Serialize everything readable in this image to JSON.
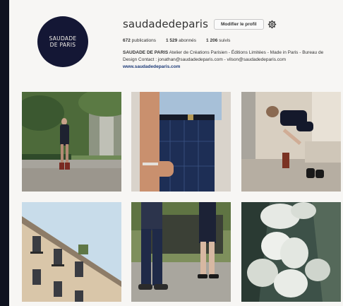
{
  "profile": {
    "avatar_line1": "SAUDADE",
    "avatar_line2": "DE PARIS",
    "username": "saudadedeparis",
    "edit_button": "Modifier le profil",
    "stats": {
      "posts_count": "672",
      "posts_label": "publications",
      "followers_count": "1 529",
      "followers_label": "abonnés",
      "following_count": "1 206",
      "following_label": "suivis"
    },
    "bio": {
      "name": "SAUDADE DE PARIS",
      "text": "Atelier de Créations Parisien - Éditions Limitées - Made in Paris - Bureau de Design Contact : jonathan@saudadedeparis.com - vilson@saudadedeparis.com",
      "link": "www.saudadedeparis.com"
    }
  },
  "icons": {
    "settings": "gear-icon"
  },
  "colors": {
    "background": "#0f1220",
    "page": "#f7f6f4",
    "avatar": "#141735",
    "link": "#1c3a78"
  }
}
